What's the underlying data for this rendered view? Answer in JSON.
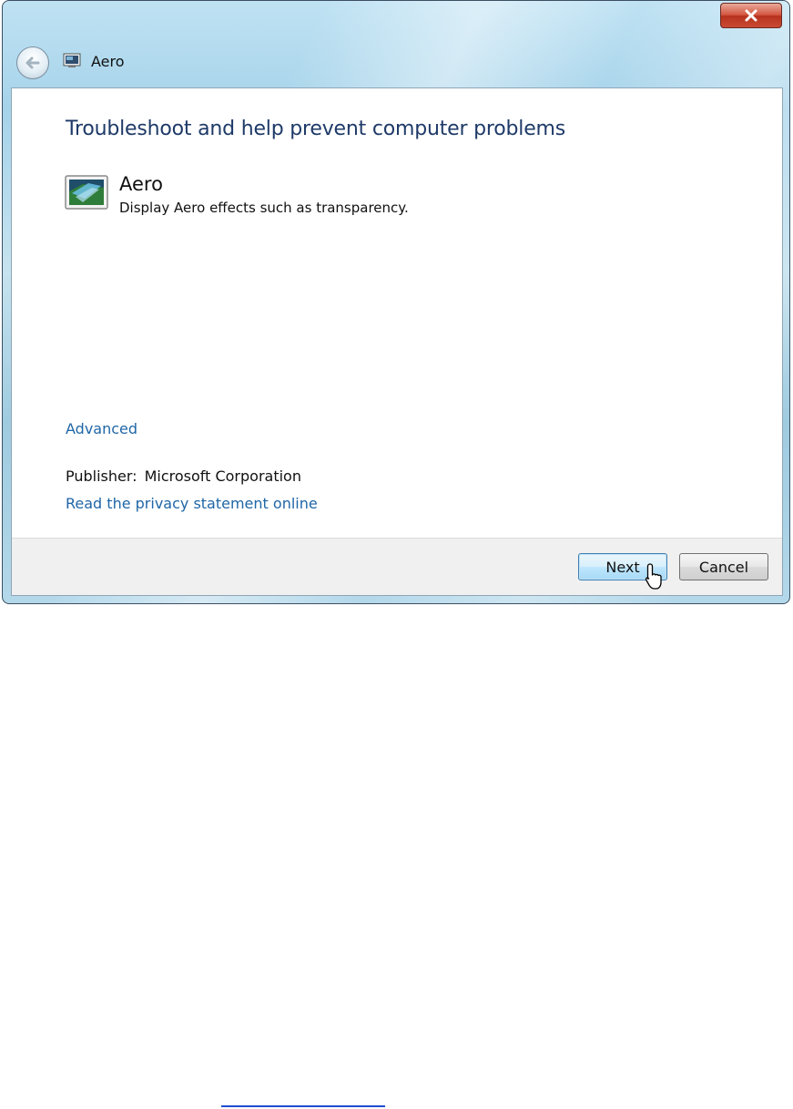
{
  "window": {
    "title": "Aero",
    "close_label": "close"
  },
  "content": {
    "heading": "Troubleshoot and help prevent computer problems",
    "item": {
      "title": "Aero",
      "description": "Display Aero effects such as transparency."
    },
    "advanced_link": "Advanced",
    "publisher_label": "Publisher:",
    "publisher_value": "Microsoft Corporation",
    "privacy_link": "Read the privacy statement online"
  },
  "footer": {
    "next_label": "Next",
    "cancel_label": "Cancel"
  },
  "icons": {
    "back": "back-arrow-icon",
    "window": "display-icon",
    "item": "aero-display-icon",
    "cursor": "pointer-cursor-icon"
  },
  "colors": {
    "heading": "#1e3a68",
    "link": "#1f66a6",
    "close_button": "#c94a32",
    "next_button": "#bee6fd"
  }
}
